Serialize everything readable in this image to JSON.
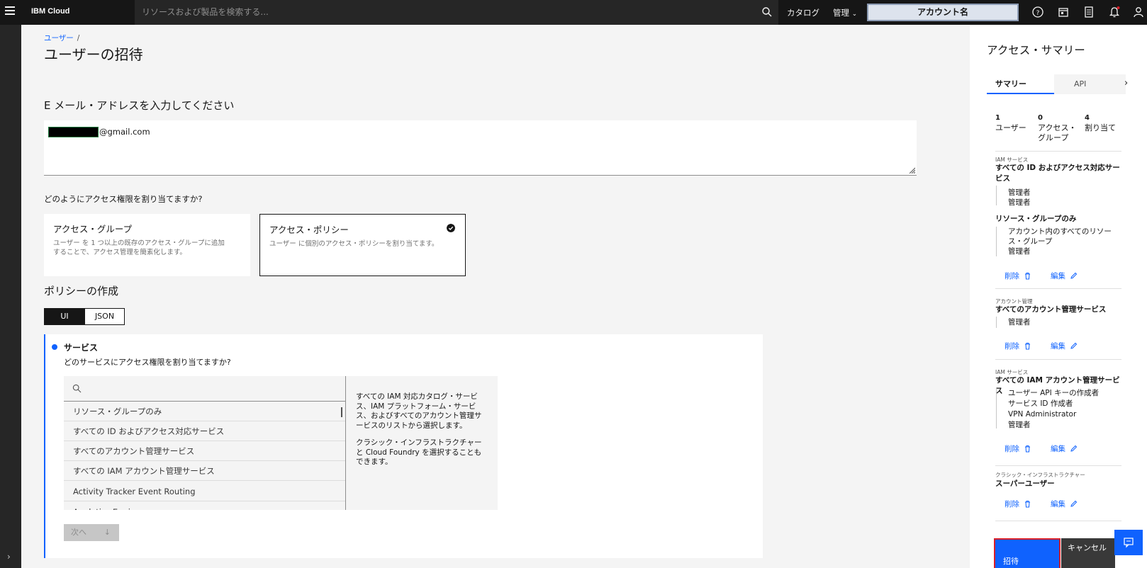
{
  "topbar": {
    "brand": "IBM Cloud",
    "search_placeholder": "リソースおよび製品を検索する...",
    "catalog": "カタログ",
    "manage": "管理",
    "account": "アカウント名"
  },
  "breadcrumb": {
    "parent": "ユーザー",
    "separator": "/"
  },
  "page_title": "ユーザーの招待",
  "email": {
    "heading": "E メール・アドレスを入力してください",
    "value_suffix": "@gmail.com"
  },
  "assign": {
    "question": "どのようにアクセス権限を割り当てますか?",
    "tiles": [
      {
        "title": "アクセス・グループ",
        "desc": "ユーザー を 1 つ以上の既存のアクセス・グループに追加することで、アクセス管理を簡素化します。",
        "selected": false
      },
      {
        "title": "アクセス・ポリシー",
        "desc": "ユーザー に個別のアクセス・ポリシーを割り当てます。",
        "selected": true
      }
    ]
  },
  "policy": {
    "heading": "ポリシーの作成",
    "toggle": [
      "UI",
      "JSON"
    ],
    "service_title": "サービス",
    "service_question": "どのサービスにアクセス権限を割り当てますか?",
    "service_items": [
      "リソース・グループのみ",
      "すべての ID およびアクセス対応サービス",
      "すべてのアカウント管理サービス",
      "すべての IAM アカウント管理サービス",
      "Activity Tracker Event Routing",
      "Analytics Engine"
    ],
    "desc_p1": "すべての IAM 対応カタログ・サービス、IAM プラットフォーム・サービス、およびすべてのアカウント管理サービスのリストから選択します。",
    "desc_p2": "クラシック・インフラストラクチャーと Cloud Foundry を選択することもできます。",
    "next": "次へ"
  },
  "summary": {
    "title": "アクセス・サマリー",
    "tabs": [
      "サマリー",
      "API"
    ],
    "stats": [
      {
        "num": "1",
        "label": "ユーザー"
      },
      {
        "num": "0",
        "label": "アクセス・グループ"
      },
      {
        "num": "4",
        "label": "割り当て"
      }
    ],
    "groups": [
      {
        "category": "IAM サービス",
        "title": "すべての ID およびアクセス対応サービス",
        "items": [
          "管理者",
          "管理者"
        ],
        "sub_title": "リソース・グループのみ",
        "sub_items": [
          "アカウント内のすべてのリソース・グループ",
          "管理者"
        ]
      },
      {
        "category": "アカウント管理",
        "title": "すべてのアカウント管理サービス",
        "items": [
          "管理者"
        ]
      },
      {
        "category": "IAM サービス",
        "title": "すべての IAM アカウント管理サービス",
        "items": [
          "ユーザー API キーの作成者",
          "サービス ID 作成者",
          "VPN Administrator",
          "管理者"
        ]
      },
      {
        "category": "クラシック・インフラストラクチャー",
        "title": "スーパーユーザー",
        "items": []
      }
    ],
    "delete": "削除",
    "edit": "編集",
    "invite": "招待",
    "cancel": "キャンセル"
  },
  "colors": {
    "accent": "#0f62fe",
    "topbar": "#161616",
    "highlight": "#da1e28"
  }
}
